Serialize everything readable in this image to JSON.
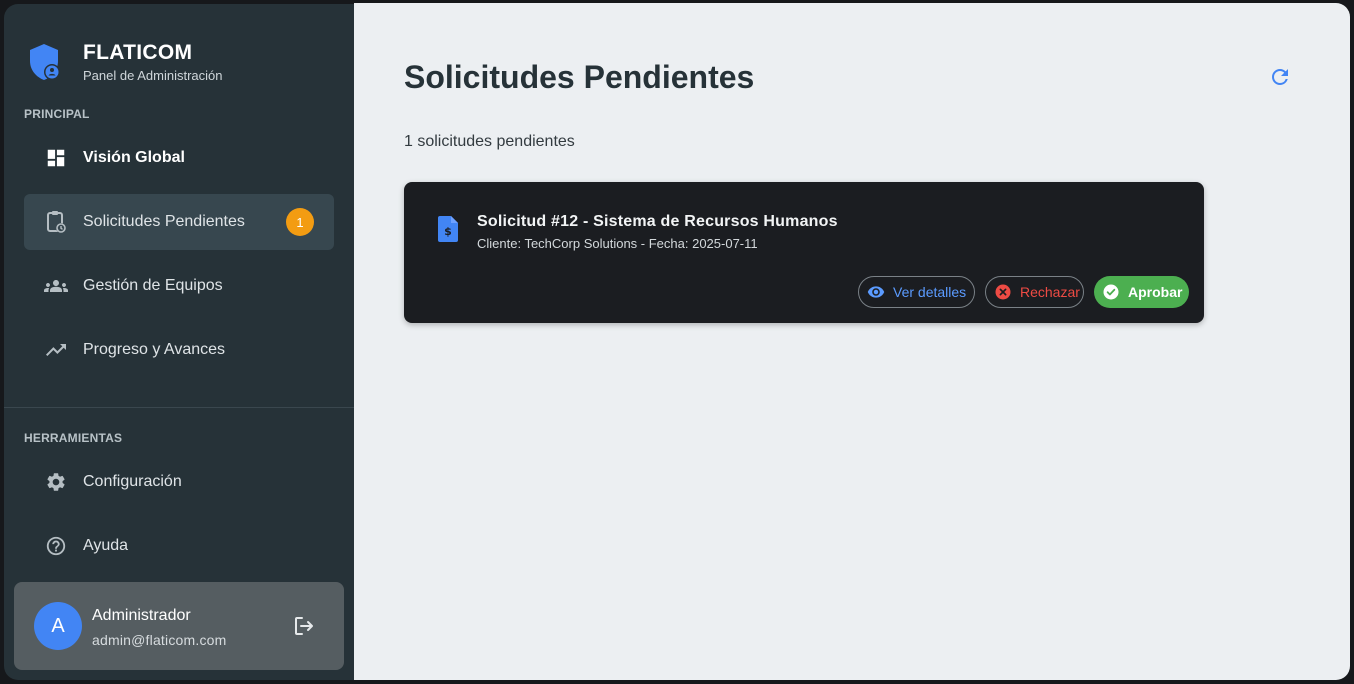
{
  "brand": {
    "title": "FLATICOM",
    "subtitle": "Panel de Administración"
  },
  "sidebar": {
    "sections": [
      {
        "label": "PRINCIPAL"
      },
      {
        "label": "HERRAMIENTAS"
      }
    ],
    "items": [
      {
        "label": "Visión Global",
        "icon": "dashboard-icon"
      },
      {
        "label": "Solicitudes Pendientes",
        "icon": "clipboard-clock-icon",
        "badge": "1",
        "active": true
      },
      {
        "label": "Gestión de Equipos",
        "icon": "groups-icon"
      },
      {
        "label": "Progreso y Avances",
        "icon": "trending-up-icon"
      },
      {
        "label": "Configuración",
        "icon": "gear-icon"
      },
      {
        "label": "Ayuda",
        "icon": "help-icon"
      }
    ],
    "user": {
      "initial": "A",
      "name": "Administrador",
      "email": "admin@flaticom.com"
    }
  },
  "main": {
    "title": "Solicitudes Pendientes",
    "count_text": "1 solicitudes pendientes",
    "requests": [
      {
        "title": "Solicitud #12 - Sistema de Recursos Humanos",
        "subtitle": "Cliente: TechCorp Solutions - Fecha: 2025-07-11",
        "actions": {
          "view": "Ver detalles",
          "reject": "Rechazar",
          "approve": "Aprobar"
        }
      }
    ]
  },
  "colors": {
    "accent": "#4285f4",
    "badge": "#f39c12",
    "approve": "#4caf50",
    "reject": "#ee4b44",
    "view": "#5b9bff",
    "sidebar_bg": "#263238",
    "main_bg": "#eceff2",
    "card_bg": "#1b1d21"
  }
}
